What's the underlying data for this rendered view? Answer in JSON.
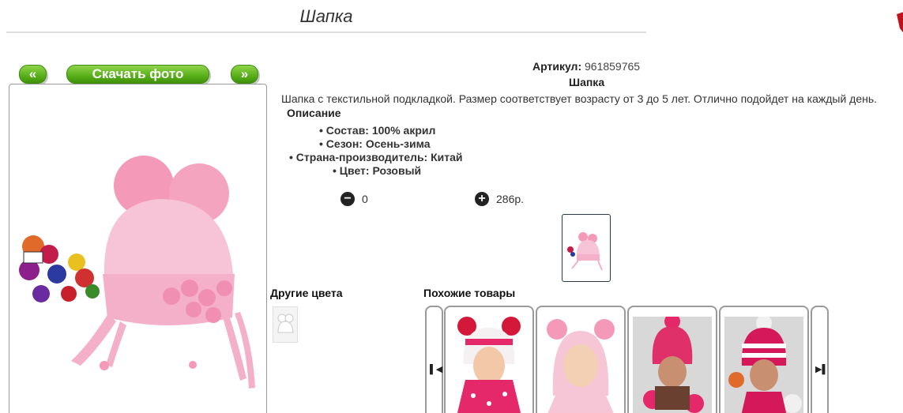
{
  "page": {
    "title": "Шапка"
  },
  "gallery": {
    "prev_label": "«",
    "download_label": "Скачать фото",
    "next_label": "»"
  },
  "product": {
    "sku_label": "Артикул:",
    "sku_value": "961859765",
    "name": "Шапка",
    "description": "Шапка с текстильной подкладкой. Размер соответствует возрасту от 3 до 5 лет. Отлично подойдет на каждый день.",
    "description_heading": "Описание",
    "attributes": [
      "Состав: 100% акрил",
      "Сезон: Осень-зима",
      "Страна-производитель: Китай",
      "Цвет: Розовый"
    ]
  },
  "cart": {
    "minus_icon": "minus-circle-icon",
    "quantity": "0",
    "plus_icon": "plus-circle-icon",
    "price": "286р."
  },
  "other_colors": {
    "heading": "Другие цвета"
  },
  "similar": {
    "heading": "Похожие товары",
    "prev_icon": "skip-back-icon",
    "next_icon": "skip-forward-icon"
  },
  "colors": {
    "accent_green": "#5cb21c",
    "hat_pink": "#f4b8cf"
  }
}
